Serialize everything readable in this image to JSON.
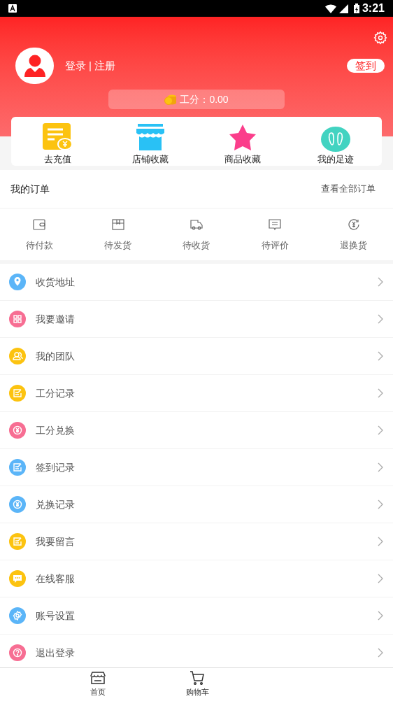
{
  "status_bar": {
    "time": "3:21"
  },
  "profile": {
    "login": "登录",
    "separator": "|",
    "register": "注册",
    "checkin": "签到",
    "points_label": "工分：0.00"
  },
  "shortcuts": [
    {
      "kind": "recharge",
      "label": "去充值"
    },
    {
      "kind": "store",
      "label": "店铺收藏"
    },
    {
      "kind": "star",
      "label": "商品收藏"
    },
    {
      "kind": "footprint",
      "label": "我的足迹"
    }
  ],
  "orders": {
    "title": "我的订单",
    "view_all": "查看全部订单",
    "statuses": [
      {
        "kind": "wallet",
        "label": "待付款"
      },
      {
        "kind": "box",
        "label": "待发货"
      },
      {
        "kind": "truck",
        "label": "待收货"
      },
      {
        "kind": "comment",
        "label": "待评价"
      },
      {
        "kind": "refund",
        "label": "退换货"
      }
    ]
  },
  "menu": [
    {
      "kind": "pin",
      "color": "#5bb5f8",
      "label": "收货地址"
    },
    {
      "kind": "qr",
      "color": "#f76e93",
      "label": "我要邀请"
    },
    {
      "kind": "team",
      "color": "#fcc310",
      "label": "我的团队"
    },
    {
      "kind": "note",
      "color": "#fcc310",
      "label": "工分记录"
    },
    {
      "kind": "yen",
      "color": "#f76e93",
      "label": "工分兑换"
    },
    {
      "kind": "note",
      "color": "#5bb5f8",
      "label": "签到记录"
    },
    {
      "kind": "yen",
      "color": "#5bb5f8",
      "label": "兑换记录"
    },
    {
      "kind": "note",
      "color": "#fcc310",
      "label": "我要留言"
    },
    {
      "kind": "chat",
      "color": "#fcc310",
      "label": "在线客服"
    },
    {
      "kind": "gear",
      "color": "#5bb5f8",
      "label": "账号设置"
    },
    {
      "kind": "help",
      "color": "#f76e93",
      "label": "退出登录"
    }
  ],
  "tab_bar": [
    {
      "kind": "home",
      "label": "首页"
    },
    {
      "kind": "cart",
      "label": "购物车"
    }
  ]
}
